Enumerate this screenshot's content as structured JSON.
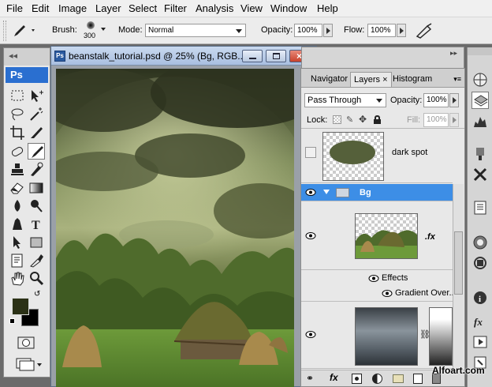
{
  "menu": [
    "File",
    "Edit",
    "Image",
    "Layer",
    "Select",
    "Filter",
    "Analysis",
    "View",
    "Window",
    "Help"
  ],
  "options": {
    "brush_label": "Brush:",
    "brush_size": "300",
    "mode_label": "Mode:",
    "mode_value": "Normal",
    "opacity_label": "Opacity:",
    "opacity_value": "100%",
    "flow_label": "Flow:",
    "flow_value": "100%"
  },
  "toolbox": {
    "logo": "Ps",
    "foreground_color": "#2b3116",
    "background_color": "#000000"
  },
  "document": {
    "title": "beanstalk_tutorial.psd @ 25% (Bg, RGB..."
  },
  "layers_panel": {
    "tabs": [
      "Navigator",
      "Layers",
      "Histogram"
    ],
    "active_tab": "Layers",
    "blend_mode": "Pass Through",
    "opacity_label": "Opacity:",
    "opacity_value": "100%",
    "lock_label": "Lock:",
    "fill_label": "Fill:",
    "fill_value": "100%",
    "layers": [
      {
        "name": "dark spot",
        "visible": false
      },
      {
        "name": "Bg",
        "type": "group",
        "visible": true,
        "selected": true
      },
      {
        "name": "",
        "fx": ".fx",
        "visible": true
      },
      {
        "effects_label": "Effects"
      },
      {
        "effect_name": "Gradient Over..."
      }
    ]
  },
  "watermark": "Alfoart.com",
  "colors": {
    "selection_blue": "#3d8ee6",
    "title_blue": "#b9cde8",
    "close_red": "#d0513c"
  }
}
